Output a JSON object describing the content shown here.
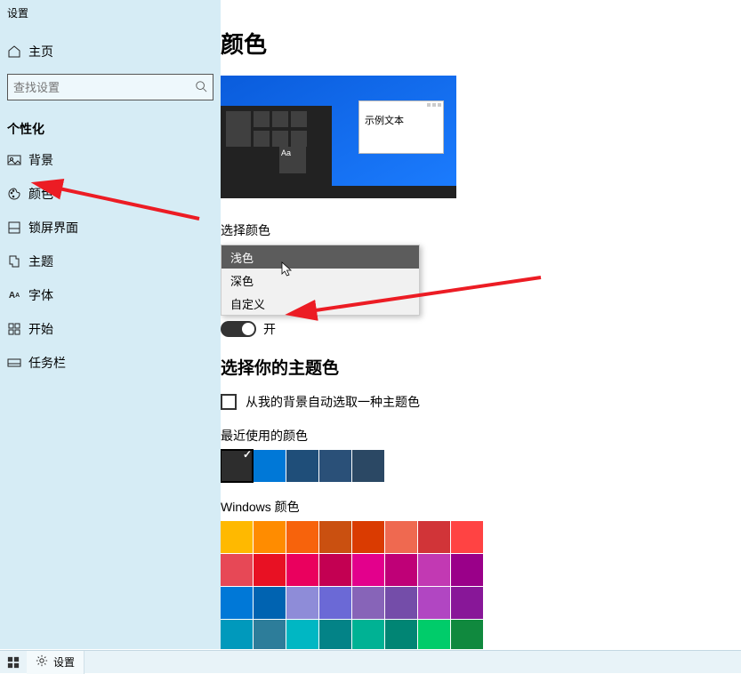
{
  "app_title": "设置",
  "sidebar": {
    "home_label": "主页",
    "search_placeholder": "查找设置",
    "category_label": "个性化",
    "items": [
      {
        "label": "背景"
      },
      {
        "label": "颜色"
      },
      {
        "label": "锁屏界面"
      },
      {
        "label": "主题"
      },
      {
        "label": "字体"
      },
      {
        "label": "开始"
      },
      {
        "label": "任务栏"
      }
    ]
  },
  "main": {
    "title": "颜色",
    "preview_sample_text": "示例文本",
    "preview_aa": "Aa",
    "choose_color_label": "选择颜色",
    "dropdown_options": [
      "浅色",
      "深色",
      "自定义"
    ],
    "toggle_on_label": "开",
    "accent_title": "选择你的主题色",
    "auto_pick_label": "从我的背景自动选取一种主题色",
    "recent_label": "最近使用的颜色",
    "recent_colors": [
      "#2d2d2d",
      "#0078d7",
      "#1f4e79",
      "#2a5078",
      "#2b4864"
    ],
    "windows_colors_label": "Windows 颜色",
    "palette": [
      "#ffb900",
      "#ff8c00",
      "#f7630c",
      "#ca5010",
      "#da3b01",
      "#ef6950",
      "#d13438",
      "#ff4343",
      "#e74856",
      "#e81123",
      "#ea005e",
      "#c30052",
      "#e3008c",
      "#bf0077",
      "#c239b3",
      "#9a0089",
      "#0078d7",
      "#0063b1",
      "#8e8cd8",
      "#6b69d6",
      "#8764b8",
      "#744da9",
      "#b146c2",
      "#881798",
      "#0099bc",
      "#2d7d9a",
      "#00b7c3",
      "#038387",
      "#00b294",
      "#018574",
      "#00cc6a",
      "#10893e"
    ]
  },
  "taskbar": {
    "active_app": "设置"
  }
}
